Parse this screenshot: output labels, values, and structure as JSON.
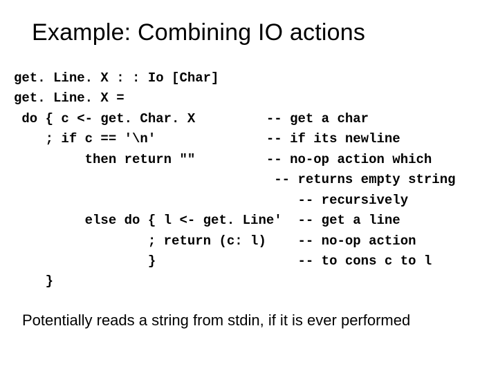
{
  "title": "Example: Combining IO actions",
  "code": "get. Line. X : : Io [Char]\nget. Line. X =\n do { c <- get. Char. X         -- get a char\n    ; if c == '\\n'              -- if its newline\n         then return \"\"         -- no-op action which\n                                 -- returns empty string\n                                    -- recursively\n         else do { l <- get. Line'  -- get a line\n                 ; return (c: l)    -- no-op action\n                 }                  -- to cons c to l\n    }",
  "footer": "Potentially reads a string from stdin,  if it is ever performed"
}
